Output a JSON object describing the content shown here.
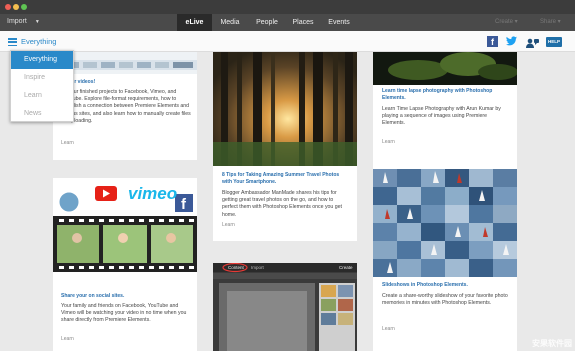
{
  "menubar": {
    "import_label": "Import",
    "tabs": [
      "eLive",
      "Media",
      "People",
      "Places",
      "Events"
    ],
    "active_tab": "eLive",
    "create_label": "Create",
    "share_label": "Share"
  },
  "subbar": {
    "filter_label": "Everything",
    "help_label": "HELP"
  },
  "dropdown": {
    "items": [
      "Everything",
      "Inspire",
      "Learn",
      "News"
    ],
    "selected": "Everything"
  },
  "cards": {
    "col1_top": {
      "title": "d your videos!",
      "body": "ad your finished projects to Facebook, Vimeo, and YouTube. Explore file-format requirements, how to establish a connection between Premiere Elements and various sites, and also learn how to manually create files for uploading.",
      "link": "Learn"
    },
    "col2_top": {
      "title": "8 Tips for Taking Amazing Summer Travel Photos with Your Smartphone.",
      "body": "Blogger Ambassador ManMade shares his tips for getting great travel photos on the go, and how to perfect them with Photoshop Elements once you get home.",
      "link": "Learn"
    },
    "col3_top": {
      "title": "Learn time lapse photography with Photoshop Elements.",
      "body": "Learn Time Lapse Photography with Arun Kumar by playing a sequence of images using Premiere Elements.",
      "link": "Learn"
    },
    "col1_bottom": {
      "vimeo_label": "vimeo",
      "title": "Share your on social sites.",
      "body": "Your family and friends on Facebook, YouTube and Vimeo will be watching your video in no time when you share directly from Premiere Elements.",
      "link": "Learn"
    },
    "col2_bottom": {
      "tab_label": "Content",
      "tab2_label": "Import",
      "create_label": "Create"
    },
    "col3_bottom": {
      "title": "Slideshows in Photoshop Elements.",
      "body": "Create a share-worthy slideshow of your favorite photo memories in minutes with Photoshop Elements.",
      "link": "Learn"
    }
  },
  "watermark": "安果软件园",
  "colors": {
    "accent": "#2a89c9",
    "dark_bar": "#4a4a4a",
    "title_blue": "#2a6fad"
  }
}
